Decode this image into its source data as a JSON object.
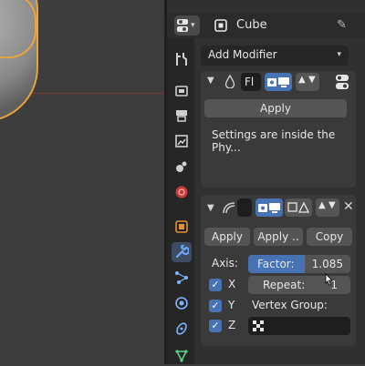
{
  "header": {
    "object_name": "Cube"
  },
  "panel": {
    "add_modifier": "Add Modifier",
    "modifier1": {
      "name_field": "Fl",
      "apply_label": "Apply",
      "info_text": "Settings are inside the Phy..."
    },
    "modifier2": {
      "apply_label": "Apply",
      "apply_as_label": "Apply ..",
      "copy_label": "Copy",
      "axis_label": "Axis:",
      "factor_label": "Factor:",
      "factor_value": "1.085",
      "repeat_label": "Repeat:",
      "repeat_value": "1",
      "x_label": "X",
      "y_label": "Y",
      "z_label": "Z",
      "vertex_group_label": "Vertex Group:",
      "axis_x_checked": true,
      "axis_y_checked": true,
      "axis_z_checked": true
    }
  },
  "colors": {
    "accent": "#4772b3",
    "selection_outline": "#e8a33c"
  }
}
